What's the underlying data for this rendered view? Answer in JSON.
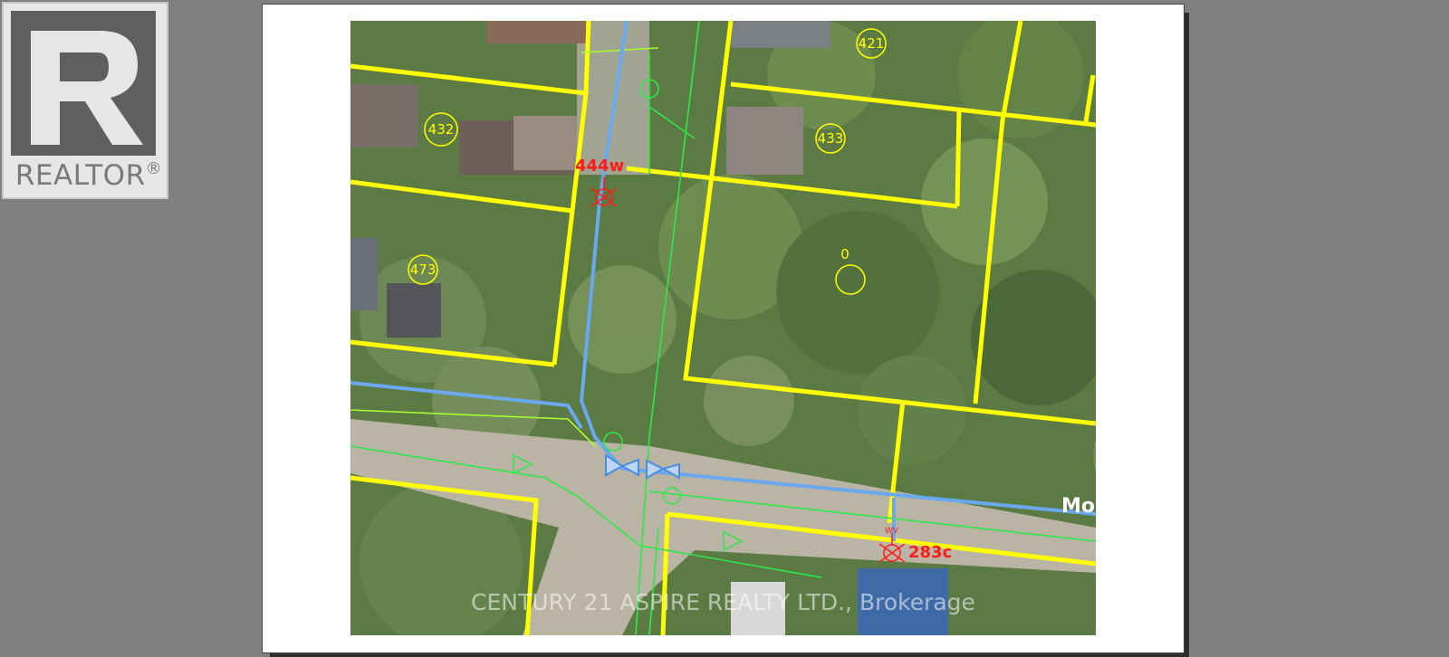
{
  "logo": {
    "word": "REALTOR",
    "registered": "®"
  },
  "map": {
    "parcel_labels": [
      "421",
      "432",
      "433",
      "473",
      "0"
    ],
    "valve_labels": [
      "444w",
      "283c"
    ],
    "wv_tag": "WV",
    "street_label": "Mo",
    "watermark": "CENTURY 21 ASPIRE REALTY LTD., Brokerage"
  },
  "colors": {
    "lot_line": "#ffff00",
    "water_main": "#6aa8f0",
    "valve_label": "#ff1a1a",
    "green_line": "#2ee84a"
  }
}
